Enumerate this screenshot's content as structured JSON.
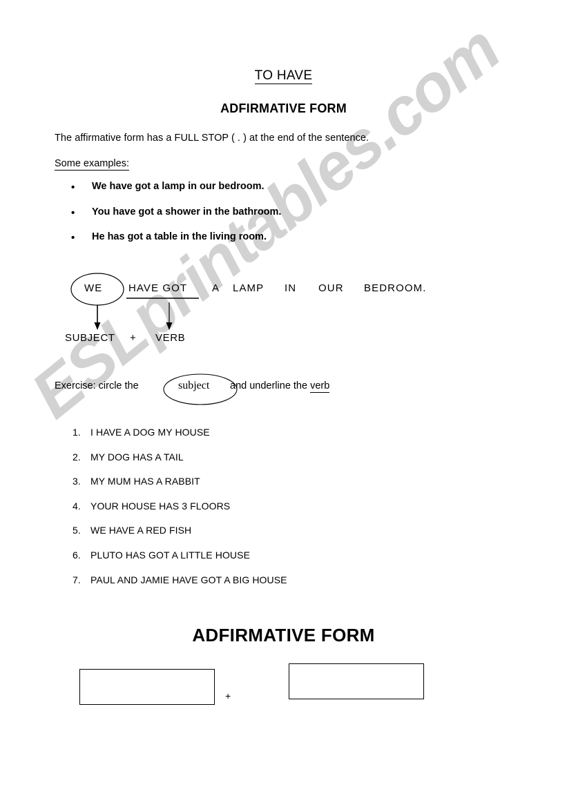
{
  "document": {
    "title_main": "TO HAVE",
    "title_sub": "ADFIRMATIVE FORM",
    "intro": "The affirmative form has a FULL STOP ( . ) at the end of the sentence.",
    "examples_heading": "Some examples:",
    "bullet_glyph": "•",
    "examples": [
      "We have got a lamp in our bedroom.",
      "You have got a shower in the bathroom.",
      "He has got a table in the living room."
    ]
  },
  "diagram": {
    "words": {
      "subject_word": "WE",
      "verb_word": "HAVE   GOT",
      "w_a": "A",
      "w_lamp": "LAMP",
      "w_in": "IN",
      "w_our": "OUR",
      "w_bedroom": "BEDROOM."
    },
    "labels": {
      "subject": "SUBJECT",
      "plus": "+",
      "verb": "VERB"
    }
  },
  "exercise": {
    "instruction_prefix": "Exercise: circle the",
    "circled_word": "subject",
    "instruction_suffix_before": "and underline the ",
    "instruction_suffix_underlined": "verb",
    "items": [
      {
        "number": "1.",
        "text": "I HAVE A DOG MY HOUSE"
      },
      {
        "number": "2.",
        "text": "MY DOG HAS A TAIL"
      },
      {
        "number": "3.",
        "text": "MY MUM HAS A RABBIT"
      },
      {
        "number": "4.",
        "text": "YOUR HOUSE HAS 3 FLOORS"
      },
      {
        "number": "5.",
        "text": "WE HAVE A RED FISH"
      },
      {
        "number": "6.",
        "text": "PLUTO HAS GOT A LITTLE HOUSE"
      },
      {
        "number": "7.",
        "text": "PAUL AND JAMIE HAVE GOT A BIG HOUSE"
      }
    ]
  },
  "bottom": {
    "heading": "ADFIRMATIVE FORM",
    "plus": "+",
    "box_left_value": "",
    "box_right_value": ""
  },
  "watermark": {
    "text": "ESLprintables.com",
    "color": "#d2d2d2"
  },
  "colors": {
    "ink": "#000000",
    "paper": "#ffffff",
    "watermark": "#d2d2d2"
  }
}
